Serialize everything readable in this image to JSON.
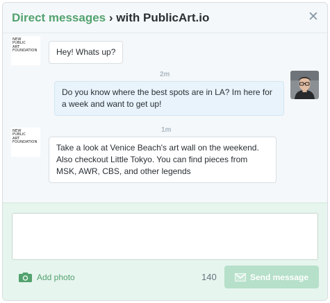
{
  "header": {
    "title_link": "Direct messages",
    "separator": "›",
    "title_with": "with PublicArt.io",
    "close_icon": "close-icon"
  },
  "org_avatar": {
    "lines": [
      "NEW",
      "PUBLIC",
      "ART",
      "FOUNDATION"
    ]
  },
  "messages": [
    {
      "sender": "org",
      "text": "Hey! Whats up?"
    },
    {
      "sender": "user",
      "time": "2m",
      "text": "Do you know where the best spots are in LA? Im here for a week and want to get up!"
    },
    {
      "sender": "org",
      "time": "1m",
      "text": "Take a look at Venice Beach's art wall on the weekend. Also checkout Little Tokyo. You can find pieces from MSK, AWR, CBS, and other legends"
    }
  ],
  "composer": {
    "text_value": "",
    "add_photo_label": "Add photo",
    "add_photo_icon": "camera-icon",
    "char_count": "140",
    "send_label": "Send message",
    "send_icon": "send-icon"
  },
  "colors": {
    "accent_green": "#52a26e",
    "composer_bg": "#e7f5ef",
    "send_disabled": "#b6e0c9",
    "outgoing_bubble": "#e8f3fb"
  }
}
